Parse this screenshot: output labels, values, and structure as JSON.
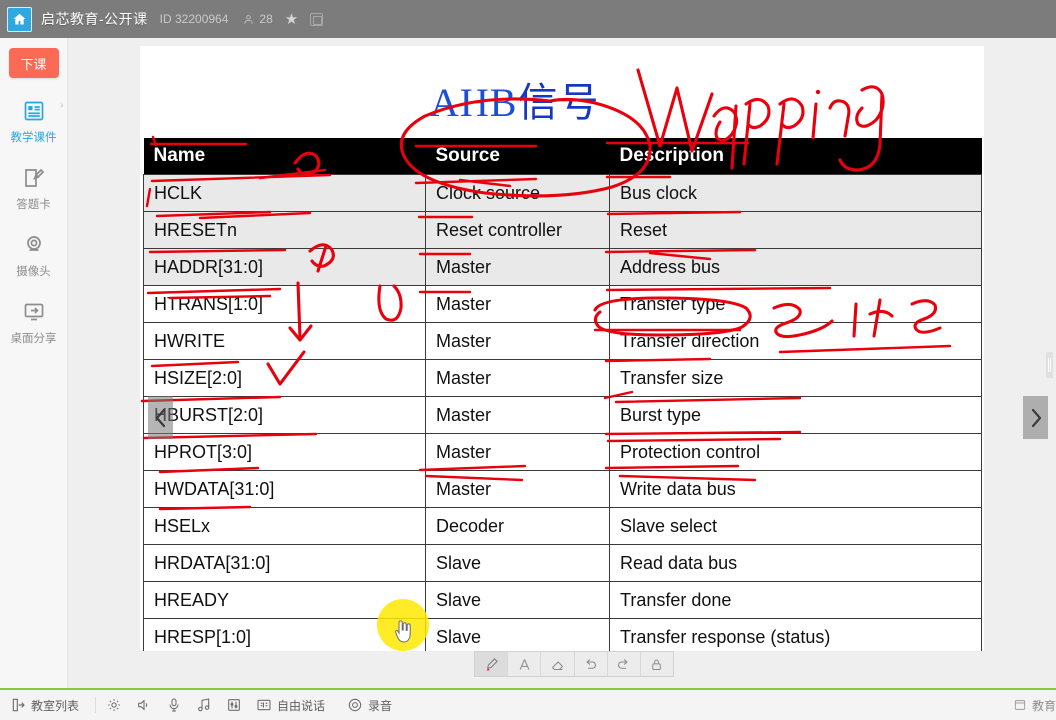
{
  "titlebar": {
    "home_icon": "home-icon",
    "room_name": "启芯教育-公开课",
    "id_label": "ID 32200964",
    "member_count": "28",
    "people_icon": "people-icon",
    "star_icon": "star-icon",
    "window_icon": "window-icon"
  },
  "sidebar": {
    "end_class_label": "下课",
    "items": [
      {
        "label": "教学课件",
        "icon": "courseware-icon",
        "active": true
      },
      {
        "label": "答题卡",
        "icon": "answer-sheet-icon",
        "active": false
      },
      {
        "label": "摄像头",
        "icon": "camera-icon",
        "active": false
      },
      {
        "label": "桌面分享",
        "icon": "screen-share-icon",
        "active": false
      }
    ],
    "expand_chevron": "chevron-right-icon"
  },
  "slide": {
    "title_latin": "AHB",
    "title_cn": "信号",
    "handwritten_note": "Wrapping",
    "table": {
      "headers": [
        "Name",
        "Source",
        "Description"
      ],
      "rows": [
        {
          "name": "HCLK",
          "source": "Clock source",
          "description": "Bus clock",
          "shaded": true
        },
        {
          "name": "HRESETn",
          "source": "Reset controller",
          "description": "Reset",
          "shaded": true
        },
        {
          "name": "HADDR[31:0]",
          "source": "Master",
          "description": "Address bus",
          "shaded": true
        },
        {
          "name": "HTRANS[1:0]",
          "source": "Master",
          "description": "Transfer type",
          "shaded": false
        },
        {
          "name": "HWRITE",
          "source": "Master",
          "description": "Transfer direction",
          "shaded": false
        },
        {
          "name": "HSIZE[2:0]",
          "source": "Master",
          "description": "Transfer size",
          "shaded": false
        },
        {
          "name": "HBURST[2:0]",
          "source": "Master",
          "description": "Burst type",
          "shaded": false
        },
        {
          "name": "HPROT[3:0]",
          "source": "Master",
          "description": "Protection control",
          "shaded": false
        },
        {
          "name": "HWDATA[31:0]",
          "source": "Master",
          "description": "Write data bus",
          "shaded": false
        },
        {
          "name": "HSELx",
          "source": "Decoder",
          "description": "Slave select",
          "shaded": false
        },
        {
          "name": "HRDATA[31:0]",
          "source": "Slave",
          "description": "Read data bus",
          "shaded": false
        },
        {
          "name": "HREADY",
          "source": "Slave",
          "description": "Transfer done",
          "shaded": false
        },
        {
          "name": "HRESP[1:0]",
          "source": "Slave",
          "description": "Transfer response (status)",
          "shaded": false
        }
      ]
    },
    "nav_prev_icon": "chevron-left-icon",
    "nav_next_icon": "chevron-right-icon"
  },
  "pen_toolbar": {
    "tools": [
      {
        "name": "pen-tool",
        "icon": "pen-icon",
        "active": true
      },
      {
        "name": "text-tool",
        "icon": "text-a-icon",
        "active": false
      },
      {
        "name": "eraser-tool",
        "icon": "eraser-icon",
        "active": false
      },
      {
        "name": "undo-tool",
        "icon": "undo-icon",
        "active": false
      },
      {
        "name": "redo-tool",
        "icon": "redo-icon",
        "active": false
      },
      {
        "name": "lock-tool",
        "icon": "lock-icon",
        "active": false
      }
    ]
  },
  "bottombar": {
    "classroom_list_label": "教室列表",
    "classroom_list_icon": "exit-arrow-icon",
    "settings_icon": "gear-icon",
    "speaker_icon": "speaker-icon",
    "mic_icon": "microphone-icon",
    "music_icon": "music-note-icon",
    "equalizer_icon": "equalizer-icon",
    "free_talk_label": "自由说话",
    "free_talk_icon": "free-talk-icon",
    "record_label": "录音",
    "record_icon": "record-circle-icon",
    "brand_label": "教育",
    "brand_icon": "window-frame-icon"
  },
  "colors": {
    "titlebar_bg": "#7c7c7c",
    "accent_blue": "#29a7e3",
    "end_class_red": "#fb6a55",
    "annotation_red": "#e8000d",
    "title_blue": "#1c4fd8",
    "bottom_accent_green": "#8dc63f",
    "cursor_highlight": "#ffe800"
  }
}
